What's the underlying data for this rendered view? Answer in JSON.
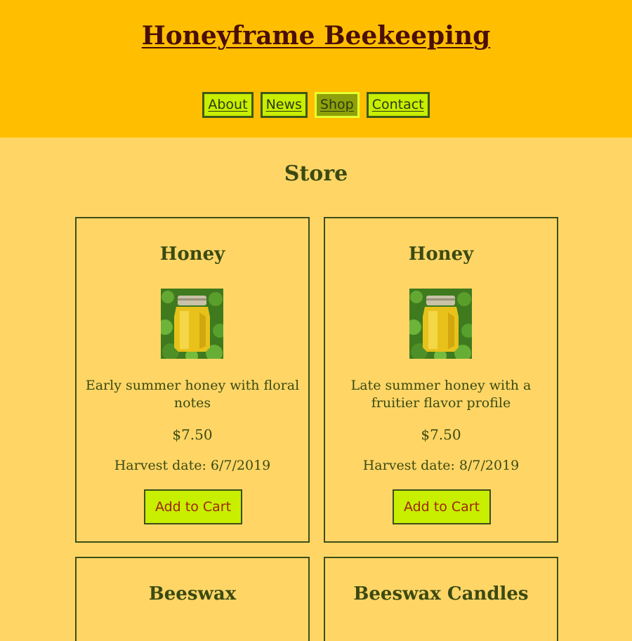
{
  "header": {
    "title": "Honeyframe Beekeeping",
    "nav": [
      {
        "label": "About",
        "active": false
      },
      {
        "label": "News",
        "active": false
      },
      {
        "label": "Shop",
        "active": true
      },
      {
        "label": "Contact",
        "active": false
      }
    ]
  },
  "main": {
    "heading": "Store",
    "products": [
      {
        "name": "Honey",
        "image": "honey-jar-icon",
        "description": "Early summer honey with floral notes",
        "price": "$7.50",
        "harvest": "Harvest date: 6/7/2019",
        "button": "Add to Cart"
      },
      {
        "name": "Honey",
        "image": "honey-jar-icon",
        "description": "Late summer honey with a fruitier flavor profile",
        "price": "$7.50",
        "harvest": "Harvest date: 8/7/2019",
        "button": "Add to Cart"
      },
      {
        "name": "Beeswax"
      },
      {
        "name": "Beeswax Candles"
      }
    ]
  },
  "colors": {
    "header_bg": "#ffbf00",
    "page_bg": "#ffd666",
    "nav_bg": "#c8ee00",
    "nav_active_bg": "#8ea10a",
    "title_color": "#4a0f05",
    "button_text": "#a0260a"
  }
}
